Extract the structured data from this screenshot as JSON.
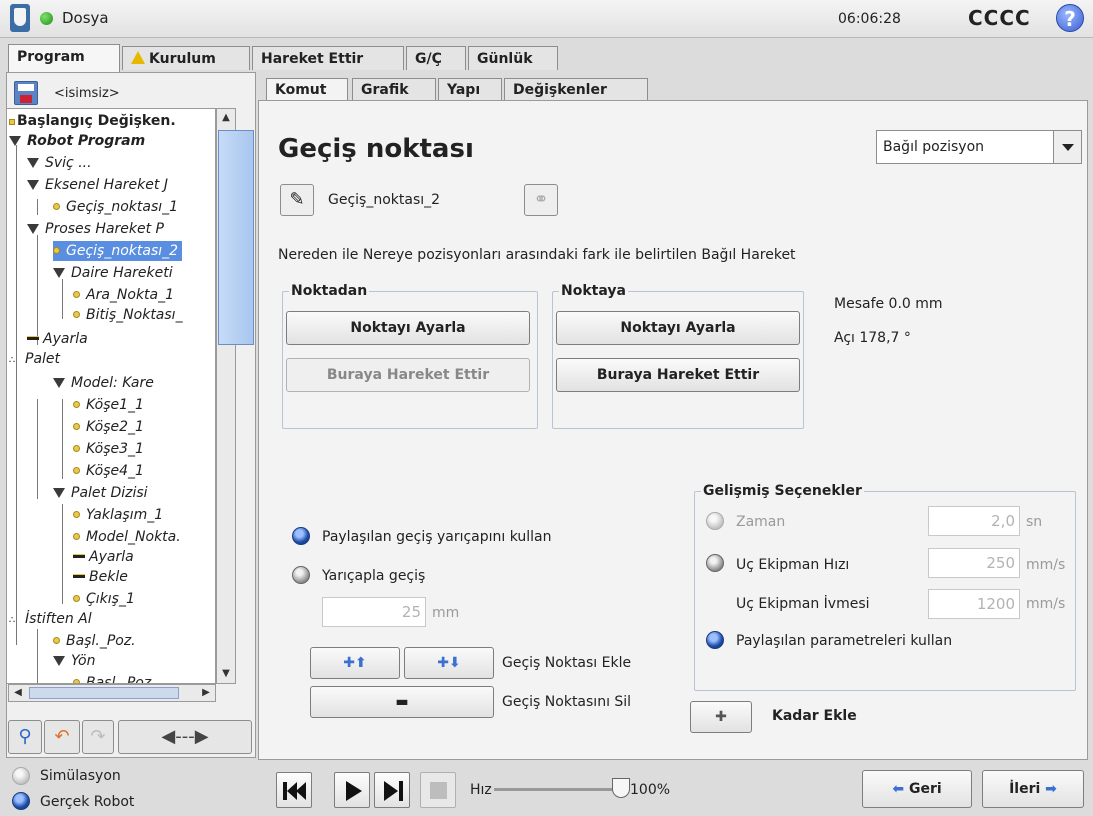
{
  "titlebar": {
    "menu": "Dosya",
    "time": "06:06:28",
    "robot_name": "CCCC",
    "help": "?"
  },
  "top_tabs": [
    "Program",
    "Kurulum",
    "Hareket Ettir",
    "G/Ç",
    "Günlük"
  ],
  "left": {
    "filename": "<isimsiz>",
    "tree": [
      {
        "label": "Başlangıç Değişken."
      },
      {
        "label": "Robot Program"
      },
      {
        "label": "Sviç ..."
      },
      {
        "label": "Eksenel Hareket J"
      },
      {
        "label": "Geçiş_noktası_1"
      },
      {
        "label": "Proses Hareket P"
      },
      {
        "label": "Geçiş_noktası_2"
      },
      {
        "label": "Daire Hareketi"
      },
      {
        "label": "Ara_Nokta_1"
      },
      {
        "label": "Bitiş_Noktası_"
      },
      {
        "label": "Ayarla"
      },
      {
        "label": "Palet"
      },
      {
        "label": "Model: Kare"
      },
      {
        "label": "Köşe1_1"
      },
      {
        "label": "Köşe2_1"
      },
      {
        "label": "Köşe3_1"
      },
      {
        "label": "Köşe4_1"
      },
      {
        "label": "Palet Dizisi"
      },
      {
        "label": "Yaklaşım_1"
      },
      {
        "label": "Model_Nokta."
      },
      {
        "label": "Ayarla"
      },
      {
        "label": "Bekle"
      },
      {
        "label": "Çıkış_1"
      },
      {
        "label": "İstiften Al"
      },
      {
        "label": "Başl._Poz."
      },
      {
        "label": "Yön"
      },
      {
        "label": "Başl._Poz."
      }
    ]
  },
  "sub_tabs": [
    "Komut",
    "Grafik",
    "Yapı",
    "Değişkenler"
  ],
  "main": {
    "title": "Geçiş noktası",
    "mode_select": "Bağıl pozisyon",
    "waypoint_name": "Geçiş_noktası_2",
    "description": "Nereden ile Nereye pozisyonları arasındaki fark ile belirtilen Bağıl Hareket",
    "from_group": "Noktadan",
    "to_group": "Noktaya",
    "set_point": "Noktayı Ayarla",
    "move_here": "Buraya Hareket Ettir",
    "distance": "Mesafe 0.0 mm",
    "angle": "Açı 178,7 °",
    "shared_blend": "Paylaşılan geçiş yarıçapını kullan",
    "blend_radius": "Yarıçapla geçiş",
    "blend_value": "25",
    "blend_unit": "mm",
    "add_waypoint": "Geçiş Noktası Ekle",
    "delete_waypoint": "Geçiş Noktasını Sil",
    "advanced": {
      "title": "Gelişmiş Seçenekler",
      "time_label": "Zaman",
      "time_value": "2,0",
      "time_unit": "sn",
      "speed_label": "Uç Ekipman Hızı",
      "speed_value": "250",
      "speed_unit": "mm/s",
      "accel_label": "Uç Ekipman İvmesi",
      "accel_value": "1200",
      "accel_unit": "mm/s",
      "shared_params": "Paylaşılan parametreleri kullan"
    },
    "add_until": "Kadar Ekle"
  },
  "bottom": {
    "simulation": "Simülasyon",
    "real_robot": "Gerçek Robot",
    "speed_label": "Hız",
    "speed_value": "100%",
    "speed_fraction": 1.0,
    "back": "Geri",
    "next": "İleri"
  }
}
